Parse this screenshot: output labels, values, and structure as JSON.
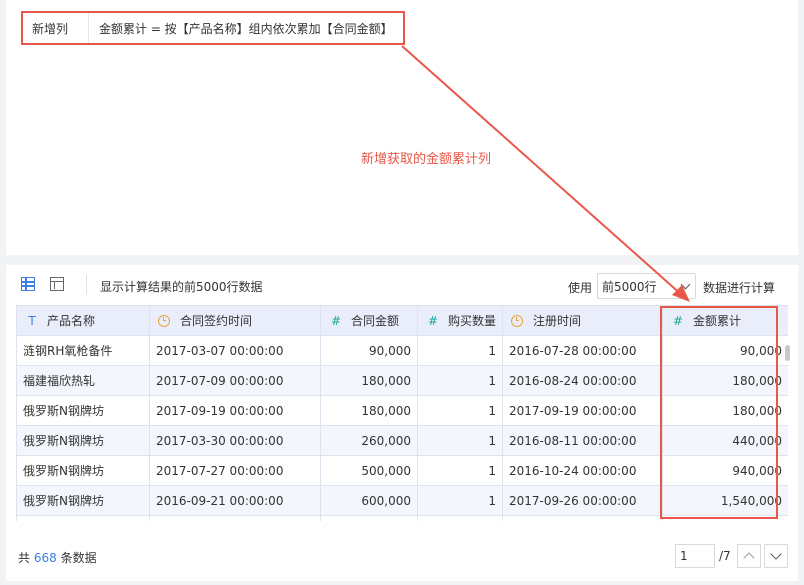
{
  "formula": {
    "label": "新增列",
    "expression": "金额累计 = 按【产品名称】组内依次累加【合同金额】"
  },
  "annotation": "新增获取的金额累计列",
  "toolbar": {
    "info_text": "显示计算结果的前5000行数据",
    "use_label": "使用",
    "select_value": "前5000行",
    "after_label": "数据进行计算"
  },
  "table": {
    "columns": [
      {
        "label": "产品名称",
        "icon": "text-type-icon"
      },
      {
        "label": "合同签约时间",
        "icon": "clock-icon"
      },
      {
        "label": "合同金额",
        "icon": "hash-icon"
      },
      {
        "label": "购买数量",
        "icon": "hash-icon"
      },
      {
        "label": "注册时间",
        "icon": "clock-icon"
      },
      {
        "label": "金额累计",
        "icon": "hash-icon"
      }
    ],
    "rows": [
      [
        "涟钢RH氧枪备件",
        "2017-03-07 00:00:00",
        "90,000",
        "1",
        "2016-07-28 00:00:00",
        "90,000"
      ],
      [
        "福建福欣热轧",
        "2017-07-09 00:00:00",
        "180,000",
        "1",
        "2016-08-24 00:00:00",
        "180,000"
      ],
      [
        "俄罗斯N钢牌坊",
        "2017-09-19 00:00:00",
        "180,000",
        "1",
        "2017-09-19 00:00:00",
        "180,000"
      ],
      [
        "俄罗斯N钢牌坊",
        "2017-03-30 00:00:00",
        "260,000",
        "1",
        "2016-08-11 00:00:00",
        "440,000"
      ],
      [
        "俄罗斯N钢牌坊",
        "2017-07-27 00:00:00",
        "500,000",
        "1",
        "2016-10-24 00:00:00",
        "940,000"
      ],
      [
        "俄罗斯N钢牌坊",
        "2016-09-21 00:00:00",
        "600,000",
        "1",
        "2017-09-26 00:00:00",
        "1,540,000"
      ]
    ]
  },
  "footer": {
    "prefix": "共",
    "count": "668",
    "suffix": "条数据",
    "page_value": "1",
    "page_total": "/7"
  },
  "colors": {
    "annotation_red": "#e8574a",
    "accent_blue": "#3d7de8",
    "hash_teal": "#19a89b",
    "clock_orange": "#e8a23a",
    "header_bg": "#e9eefa"
  }
}
